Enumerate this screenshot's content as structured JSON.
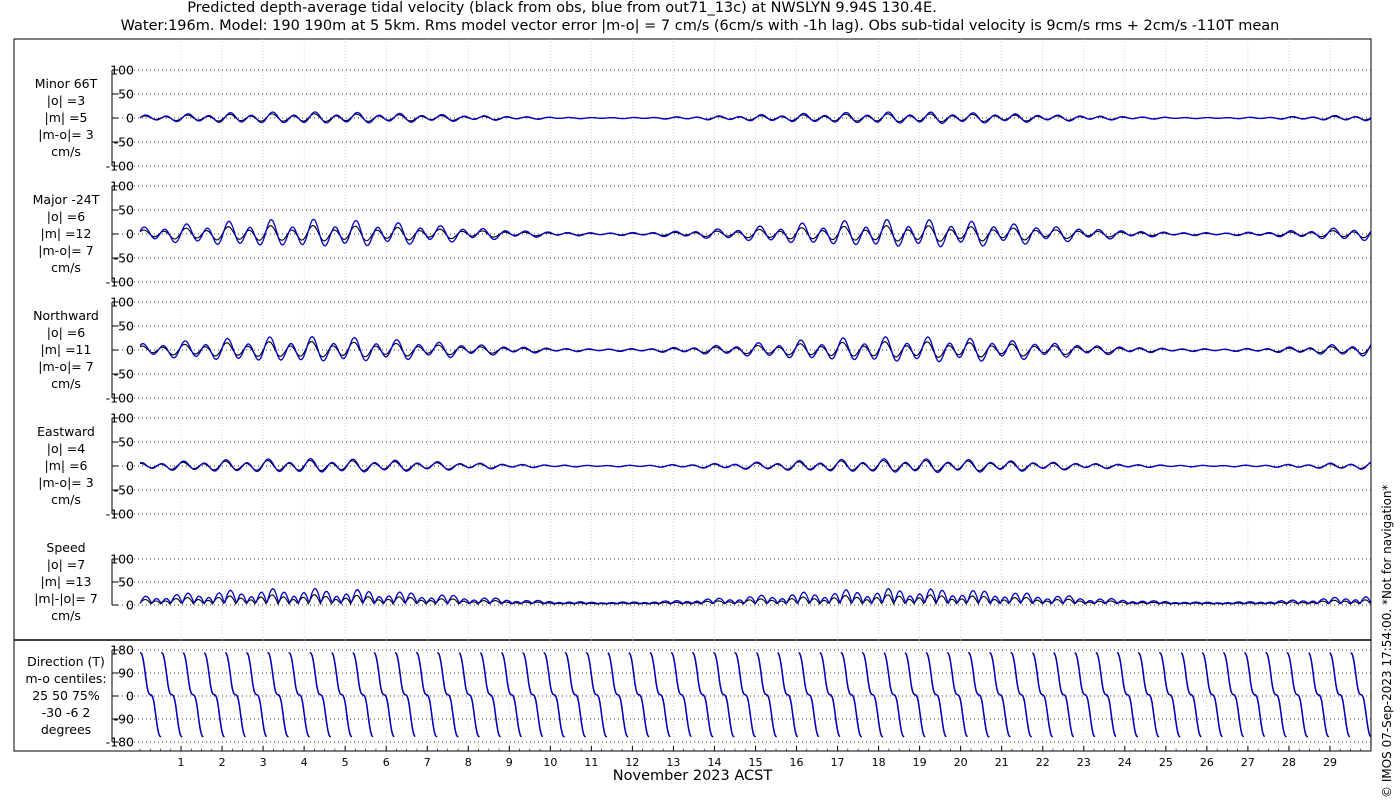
{
  "chart_data": {
    "type": "line",
    "title": "Predicted depth-average tidal velocity (black from obs, blue from out71_13c) at NWSLYN 9.94S 130.4E.",
    "subtitle": "Water:196m. Model: 190 190m at 5 5km. Rms model vector error |m-o| = 7 cm/s (6cm/s with -1h lag). Obs sub-tidal velocity is 9cm/s rms + 2cm/s -110T mean",
    "xlabel": "November 2023 ACST",
    "x_ticks": [
      "1",
      "2",
      "3",
      "4",
      "5",
      "6",
      "7",
      "8",
      "9",
      "10",
      "11",
      "12",
      "13",
      "14",
      "15",
      "16",
      "17",
      "18",
      "19",
      "20",
      "21",
      "22",
      "23",
      "24",
      "25",
      "26",
      "27",
      "28",
      "29"
    ],
    "xlim": [
      0,
      30
    ],
    "colors": {
      "obs": "#000000",
      "model": "#0000cc"
    },
    "panels": [
      {
        "name": "Minor 66T",
        "stats": [
          "Minor 66T",
          "|o| =3",
          "|m| =5",
          "|m-o|= 3",
          "cm/s"
        ],
        "ylim": [
          -100,
          100
        ],
        "yticks": [
          "100",
          "50",
          "0",
          "-50",
          "-100"
        ],
        "amp_obs": 3,
        "amp_model": 5
      },
      {
        "name": "Major -24T",
        "stats": [
          "Major -24T",
          "|o| =6",
          "|m| =12",
          "|m-o|= 7",
          "cm/s"
        ],
        "ylim": [
          -100,
          100
        ],
        "yticks": [
          "100",
          "50",
          "0",
          "-50",
          "-100"
        ],
        "amp_obs": 6,
        "amp_model": 12
      },
      {
        "name": "Northward",
        "stats": [
          "Northward",
          "|o| =6",
          "|m| =11",
          "|m-o|= 7",
          "cm/s"
        ],
        "ylim": [
          -100,
          100
        ],
        "yticks": [
          "100",
          "50",
          "0",
          "-50",
          "-100"
        ],
        "amp_obs": 6,
        "amp_model": 11
      },
      {
        "name": "Eastward",
        "stats": [
          "Eastward",
          "|o| =4",
          "|m| =6",
          "|m-o|= 3",
          "cm/s"
        ],
        "ylim": [
          -100,
          100
        ],
        "yticks": [
          "100",
          "50",
          "0",
          "-50",
          "-100"
        ],
        "amp_obs": 4,
        "amp_model": 6
      },
      {
        "name": "Speed",
        "stats": [
          "Speed",
          "|o| =7",
          "|m| =13",
          "|m|-|o|= 7",
          "cm/s"
        ],
        "ylim": [
          0,
          100
        ],
        "yticks": [
          "100",
          "50",
          "0"
        ],
        "amp_obs": 7,
        "amp_model": 13
      }
    ],
    "direction_panel": {
      "stats": [
        "Direction (T)",
        "m-o centiles:",
        "25  50  75%",
        "-30  -6   2",
        "degrees"
      ],
      "ylim": [
        -180,
        180
      ],
      "yticks": [
        "180",
        "90",
        "0",
        "-90",
        "-180"
      ]
    },
    "grid": true
  },
  "copyright": "© IMOS 07-Sep-2023 17:54:00. *Not for navigation*"
}
